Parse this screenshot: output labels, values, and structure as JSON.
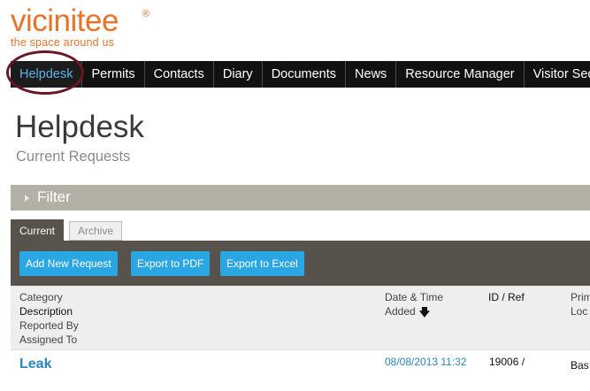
{
  "brand": {
    "name": "vicinitee",
    "registered": "®",
    "tagline": "the space around us",
    "color": "#e8742a"
  },
  "nav": {
    "items": [
      {
        "label": "Helpdesk",
        "active": true
      },
      {
        "label": "Permits",
        "active": false
      },
      {
        "label": "Contacts",
        "active": false
      },
      {
        "label": "Diary",
        "active": false
      },
      {
        "label": "Documents",
        "active": false
      },
      {
        "label": "News",
        "active": false
      },
      {
        "label": "Resource Manager",
        "active": false
      },
      {
        "label": "Visitor Secur",
        "active": false
      }
    ]
  },
  "page": {
    "title": "Helpdesk",
    "subtitle": "Current Requests"
  },
  "filter": {
    "label": "Filter"
  },
  "tabs": [
    {
      "label": "Current",
      "active": true
    },
    {
      "label": "Archive",
      "active": false
    }
  ],
  "actions": {
    "add": "Add New Request",
    "pdf": "Export to PDF",
    "excel": "Export to Excel"
  },
  "table": {
    "headers": {
      "category": "Category",
      "description": "Description",
      "reported_by": "Reported By",
      "assigned_to": "Assigned To",
      "date_time": "Date & Time",
      "added": "Added",
      "id_ref": "ID / Ref",
      "pri": "Prim",
      "loc": "Loc"
    },
    "rows": [
      {
        "title": "Leak",
        "date": "08/08/2013 11:32",
        "id": "19006 /",
        "location": "Bas"
      }
    ]
  }
}
